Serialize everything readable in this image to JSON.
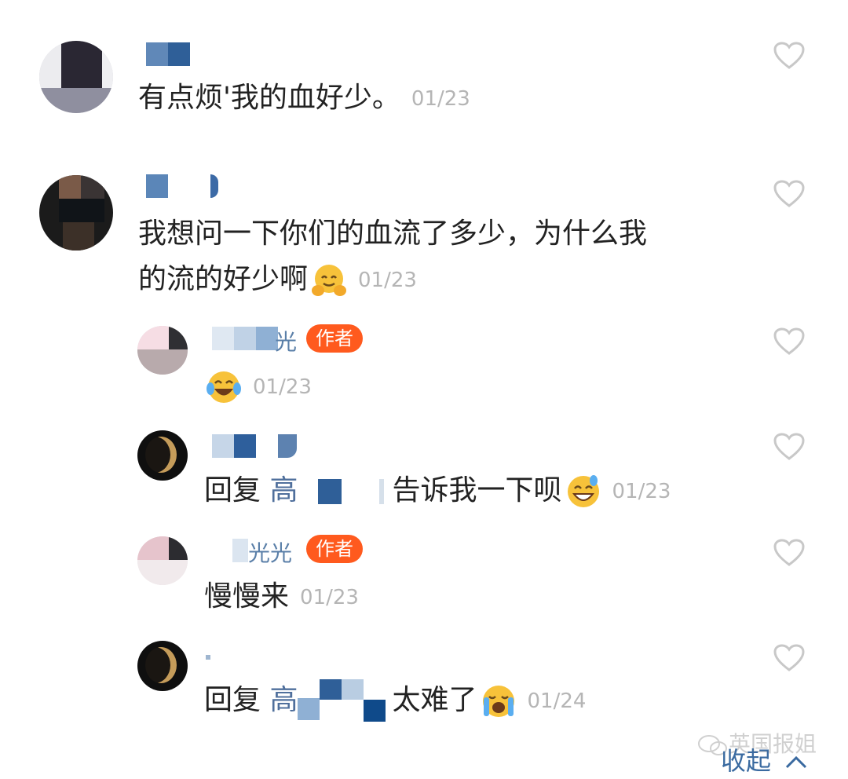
{
  "comments": [
    {
      "text": "有点烦'我的血好少。",
      "time": "01/23"
    },
    {
      "text_line1": "我想问一下你们的血流了多少，为什么我",
      "text_line2": "的流的好少啊",
      "time": "01/23"
    }
  ],
  "replies": [
    {
      "name_fragment": "光",
      "badge": "作者",
      "time": "01/23"
    },
    {
      "prefix": "回复",
      "reply_to": "高",
      "text": "告诉我一下呗",
      "time": "01/23"
    },
    {
      "name_fragment": "光光",
      "badge": "作者",
      "text": "慢慢来",
      "time": "01/23"
    },
    {
      "prefix": "回复",
      "reply_to": "高",
      "text": "太难了",
      "time": "01/24"
    }
  ],
  "watermark": "英国报姐",
  "collapse_label": "收起",
  "icons": {
    "like": "heart-outline-icon",
    "collapse": "chevron-up-icon",
    "emoji_hug": "hugging-face-emoji",
    "emoji_tears": "tears-of-joy-emoji",
    "emoji_sweat": "grinning-sweat-emoji",
    "emoji_cry": "loudly-crying-emoji",
    "wechat": "wechat-logo-icon"
  },
  "colors": {
    "author_badge": "#ff5a1e",
    "link": "#3a6aa0",
    "timestamp": "#b5b5b5"
  }
}
